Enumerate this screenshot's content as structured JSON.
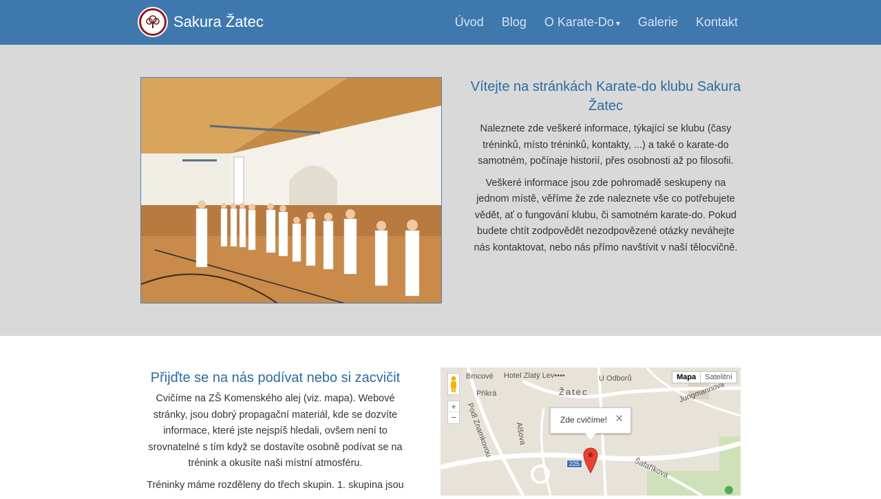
{
  "brand": {
    "name": "Sakura Žatec"
  },
  "nav": {
    "items": [
      {
        "label": "Úvod"
      },
      {
        "label": "Blog"
      },
      {
        "label": "O Karate-Do",
        "dropdown": true
      },
      {
        "label": "Galerie"
      },
      {
        "label": "Kontakt"
      }
    ],
    "caret": "▾"
  },
  "hero": {
    "title": "Vítejte na stránkách Karate-do klubu Sakura Žatec",
    "paragraphs": [
      "Naleznete zde veškeré informace, týkající se klubu (časy tréninků, místo tréninků, kontakty, ...) a také o karate-do samotném, počínaje historií, přes osobnosti až po filosofii.",
      "Veškeré informace jsou zde pohromadě seskupeny na jednom místě, věříme že zde naleznete vše co potřebujete vědět, ať o fungování klubu, či samotném karate-do. Pokud budete chtít zodpovědět nezodpovězené otázky neváhejte nás kontaktovat, nebo nás přímo navštívit v naší tělocvičně."
    ]
  },
  "lower": {
    "title": "Přijďte se na nás podívat nebo si zacvičit",
    "paragraphs": [
      "Cvičíme na ZŠ Komenského alej (viz. mapa). Webové stránky, jsou dobrý propagační materiál, kde se dozvíte informace, které jste nejspíš hledali, ovšem není to srovnatelné s tím když se dostavíte osobně podívat se na trénink a okusíte naši místní atmosféru.",
      "Tréninky máme rozděleny do třech skupin. 1. skupina jsou"
    ]
  },
  "map": {
    "type_buttons": [
      "Mapa",
      "Satelitní"
    ],
    "zoom_in": "+",
    "zoom_out": "−",
    "infowindow_text": "Zde cvičíme!",
    "close_symbol": "✕",
    "labels": {
      "hotel": "Hotel Zlatý Lev••••",
      "city": "Žatec",
      "street1": "Příkrá",
      "street2": "Alšova",
      "street3": "Šafaříkova",
      "street4": "Podl Znamkovou",
      "street5": "U Odborů",
      "street6": "Jungmannova",
      "street7": "Bmcové",
      "road": "225"
    }
  }
}
